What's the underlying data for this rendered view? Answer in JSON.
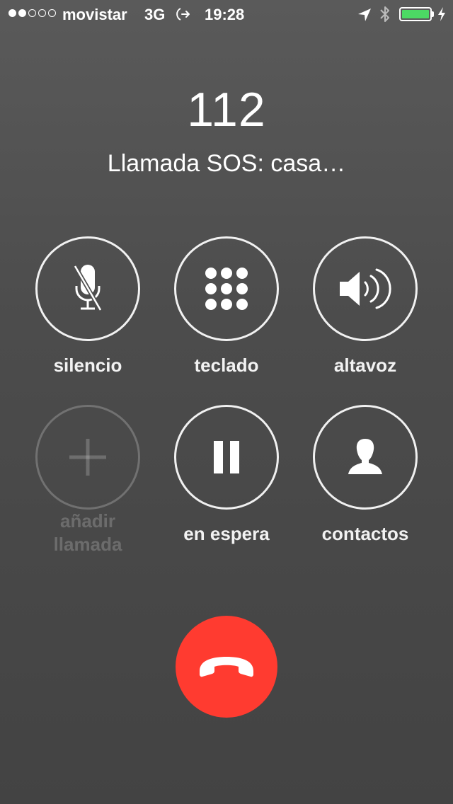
{
  "status_bar": {
    "signal_bars_filled": 2,
    "signal_bars_total": 5,
    "carrier": "movistar",
    "network": "3G",
    "time": "19:28",
    "battery_color": "#4cd964",
    "icons": [
      "sync-icon",
      "location-icon",
      "bluetooth-icon",
      "battery-icon",
      "charging-icon"
    ]
  },
  "call": {
    "number": "112",
    "status": "Llamada SOS: casa…"
  },
  "buttons": {
    "mute": {
      "label": "silencio",
      "icon": "microphone-muted-icon"
    },
    "keypad": {
      "label": "teclado",
      "icon": "keypad-icon"
    },
    "speaker": {
      "label": "altavoz",
      "icon": "speaker-icon"
    },
    "add_call": {
      "label": "añadir llamada",
      "icon": "plus-icon",
      "enabled": false
    },
    "hold": {
      "label": "en espera",
      "icon": "pause-icon"
    },
    "contacts": {
      "label": "contactos",
      "icon": "person-icon"
    }
  },
  "end_call": {
    "icon": "hang-up-icon",
    "color": "#ff3b30"
  }
}
